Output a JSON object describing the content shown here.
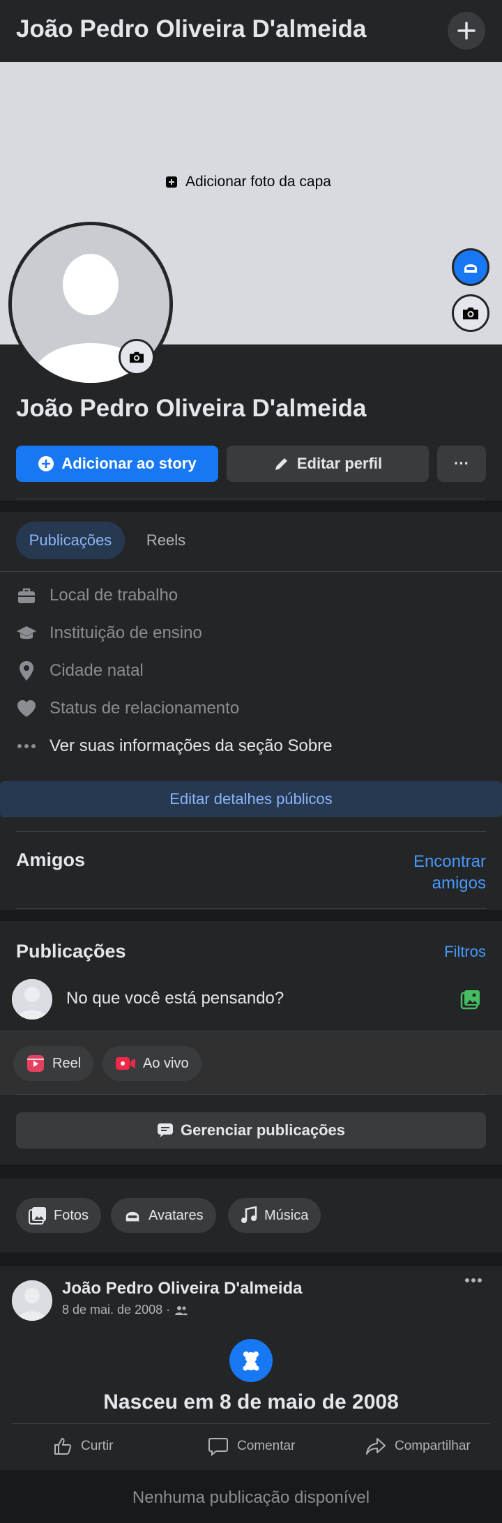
{
  "header": {
    "title": "João Pedro Oliveira D'almeida",
    "plus_icon": "plus-icon"
  },
  "cover": {
    "add_label": "Adicionar foto da capa"
  },
  "profile": {
    "name": "João Pedro Oliveira D'almeida"
  },
  "actions": {
    "story_label": "Adicionar ao story",
    "edit_label": "Editar perfil",
    "more_label": "···"
  },
  "tabs": [
    {
      "label": "Publicações",
      "active": true
    },
    {
      "label": "Reels",
      "active": false
    }
  ],
  "about": {
    "items": [
      {
        "label": "Local de trabalho",
        "icon": "briefcase-icon"
      },
      {
        "label": "Instituição de ensino",
        "icon": "graduation-cap-icon"
      },
      {
        "label": "Cidade natal",
        "icon": "location-pin-icon"
      },
      {
        "label": "Status de relacionamento",
        "icon": "heart-icon"
      },
      {
        "label": "Ver suas informações da seção Sobre",
        "icon": "more-dots-icon"
      }
    ],
    "edit_details_label": "Editar detalhes públicos"
  },
  "friends": {
    "title": "Amigos",
    "find_label_line1": "Encontrar",
    "find_label_line2": "amigos"
  },
  "posts": {
    "title": "Publicações",
    "filters_label": "Filtros",
    "composer_placeholder": "No que você está pensando?",
    "reel_label": "Reel",
    "live_label": "Ao vivo",
    "manage_label": "Gerenciar publicações"
  },
  "media_pills": [
    {
      "label": "Fotos"
    },
    {
      "label": "Avatares"
    },
    {
      "label": "Música"
    }
  ],
  "post": {
    "author": "João Pedro Oliveira D'almeida",
    "date": "8 de mai. de 2008 ·",
    "event_text": "Nasceu em 8 de maio de 2008",
    "like_label": "Curtir",
    "comment_label": "Comentar",
    "share_label": "Compartilhar"
  },
  "footer": {
    "message": "Nenhuma publicação disponível"
  },
  "colors": {
    "accent": "#1877f2",
    "background": "#242526",
    "band": "#18191a",
    "cover": "#d8dadf"
  }
}
